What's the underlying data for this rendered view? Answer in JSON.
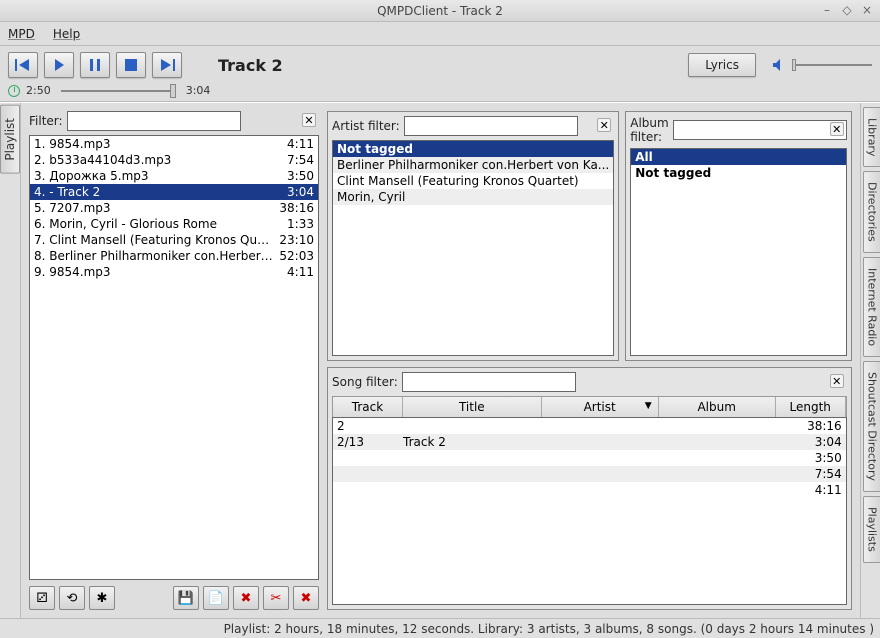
{
  "window": {
    "title": "QMPDClient - Track  2"
  },
  "menu": {
    "mpd": "MPD",
    "help": "Help"
  },
  "toolbar": {
    "track_title": "Track  2",
    "lyrics": "Lyrics",
    "time_current": "2:50",
    "time_total": "3:04"
  },
  "left_tab": {
    "playlist": "Playlist"
  },
  "right_tabs": {
    "library": "Library",
    "directories": "Directories",
    "internet_radio": "Internet Radio",
    "shoutcast": "Shoutcast Directory",
    "playlists": "Playlists"
  },
  "playlist": {
    "filter_label": "Filter:",
    "items": [
      {
        "n": "1.",
        "label": "9854.mp3",
        "dur": "4:11",
        "sel": false
      },
      {
        "n": "2.",
        "label": "b533a44104d3.mp3",
        "dur": "7:54",
        "sel": false
      },
      {
        "n": "3.",
        "label": "Дорожка 5.mp3",
        "dur": "3:50",
        "sel": false
      },
      {
        "n": "4.",
        "label": " - Track  2",
        "dur": "3:04",
        "sel": true
      },
      {
        "n": "5.",
        "label": "7207.mp3",
        "dur": "38:16",
        "sel": false
      },
      {
        "n": "6.",
        "label": "Morin, Cyril - Glorious Rome",
        "dur": "1:33",
        "sel": false
      },
      {
        "n": "7.",
        "label": "Clint Mansell (Featuring Kronos Quartet) ...",
        "dur": "23:10",
        "sel": false
      },
      {
        "n": "8.",
        "label": "Berliner Philharmoniker con.Herbert von ...",
        "dur": "52:03",
        "sel": false
      },
      {
        "n": "9.",
        "label": "9854.mp3",
        "dur": "4:11",
        "sel": false
      }
    ]
  },
  "artist": {
    "filter_label": "Artist filter:",
    "items": [
      {
        "text": "Not tagged",
        "hdr": true
      },
      {
        "text": "Berliner Philharmoniker con.Herbert von Ka...",
        "alt": true
      },
      {
        "text": "Clint Mansell (Featuring Kronos Quartet)"
      },
      {
        "text": "Morin, Cyril",
        "alt": true
      }
    ]
  },
  "album": {
    "filter_label": "Album filter:",
    "items": [
      {
        "text": "All",
        "hdr": true
      },
      {
        "text": "Not tagged",
        "bold": true
      }
    ]
  },
  "songs": {
    "filter_label": "Song filter:",
    "headers": {
      "track": "Track",
      "title": "Title",
      "artist": "Artist",
      "album": "Album",
      "length": "Length"
    },
    "rows": [
      {
        "track": "2",
        "title": "",
        "artist": "",
        "album": "",
        "len": "38:16",
        "alt": false
      },
      {
        "track": "2/13",
        "title": "Track  2",
        "artist": "",
        "album": "",
        "len": "3:04",
        "alt": true
      },
      {
        "track": "",
        "title": "",
        "artist": "",
        "album": "",
        "len": "3:50",
        "alt": false
      },
      {
        "track": "",
        "title": "",
        "artist": "",
        "album": "",
        "len": "7:54",
        "alt": true
      },
      {
        "track": "",
        "title": "",
        "artist": "",
        "album": "",
        "len": "4:11",
        "alt": false
      }
    ]
  },
  "status": "Playlist: 2 hours, 18 minutes, 12 seconds.  Library:  3 artists, 3 albums, 8 songs. (0 days 2 hours 14 minutes )"
}
